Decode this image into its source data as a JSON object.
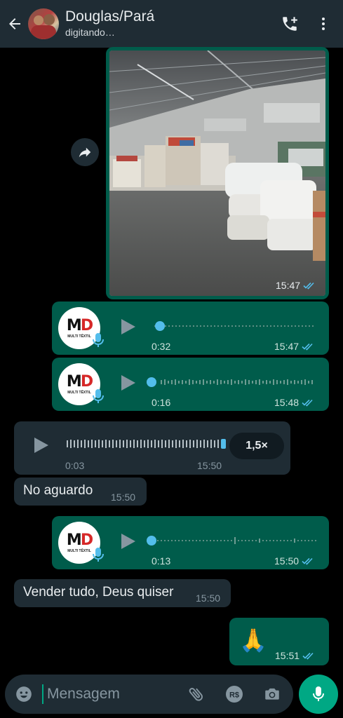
{
  "header": {
    "contact_name": "Douglas/Pará",
    "status": "digitando…"
  },
  "messages": {
    "image": {
      "time": "15:47"
    },
    "voice1": {
      "duration": "0:32",
      "time": "15:47"
    },
    "voice2": {
      "duration": "0:16",
      "time": "15:48"
    },
    "voice3": {
      "duration": "0:03",
      "time": "15:50",
      "speed": "1,5×"
    },
    "text1": {
      "text": "No aguardo",
      "time": "15:50"
    },
    "voice4": {
      "duration": "0:13",
      "time": "15:50"
    },
    "text2": {
      "text": "Vender tudo, Deus quiser",
      "time": "15:50"
    },
    "emoji": {
      "text": "🙏",
      "time": "15:51"
    }
  },
  "logo": {
    "mark": "MD",
    "m": "M",
    "d": "D",
    "sub": "MULTI TÊXTIL"
  },
  "input": {
    "placeholder": "Mensagem"
  },
  "colors": {
    "outgoing": "#005c4b",
    "incoming": "#1f2c34",
    "accent": "#00a884",
    "read_ticks": "#53bdeb"
  },
  "icons": [
    "back-arrow-icon",
    "add-call-icon",
    "more-vert-icon",
    "forward-icon",
    "play-icon",
    "mic-icon",
    "emoji-icon",
    "attach-icon",
    "payment-icon",
    "camera-icon",
    "double-check-icon"
  ]
}
